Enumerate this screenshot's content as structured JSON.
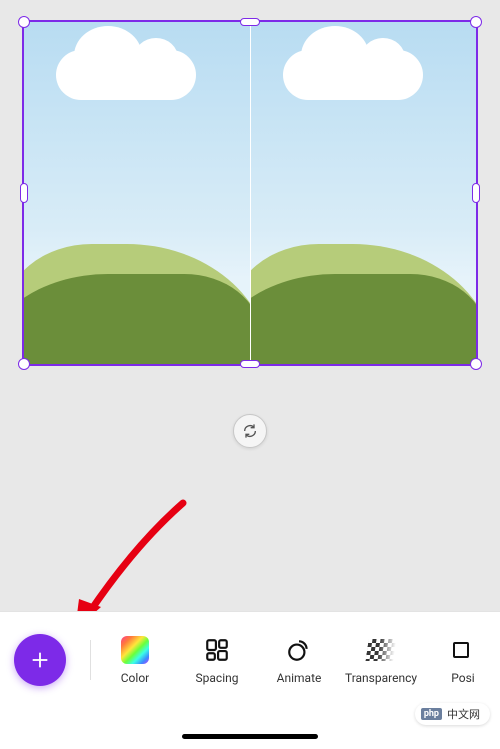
{
  "canvas": {
    "image_label_left": "landscape-image",
    "image_label_right": "landscape-image"
  },
  "toolbar": {
    "add_label": "Add",
    "color_label": "Color",
    "spacing_label": "Spacing",
    "animate_label": "Animate",
    "transparency_label": "Transparency",
    "position_label": "Posi"
  },
  "watermark": {
    "badge": "php",
    "text": "中文网"
  }
}
